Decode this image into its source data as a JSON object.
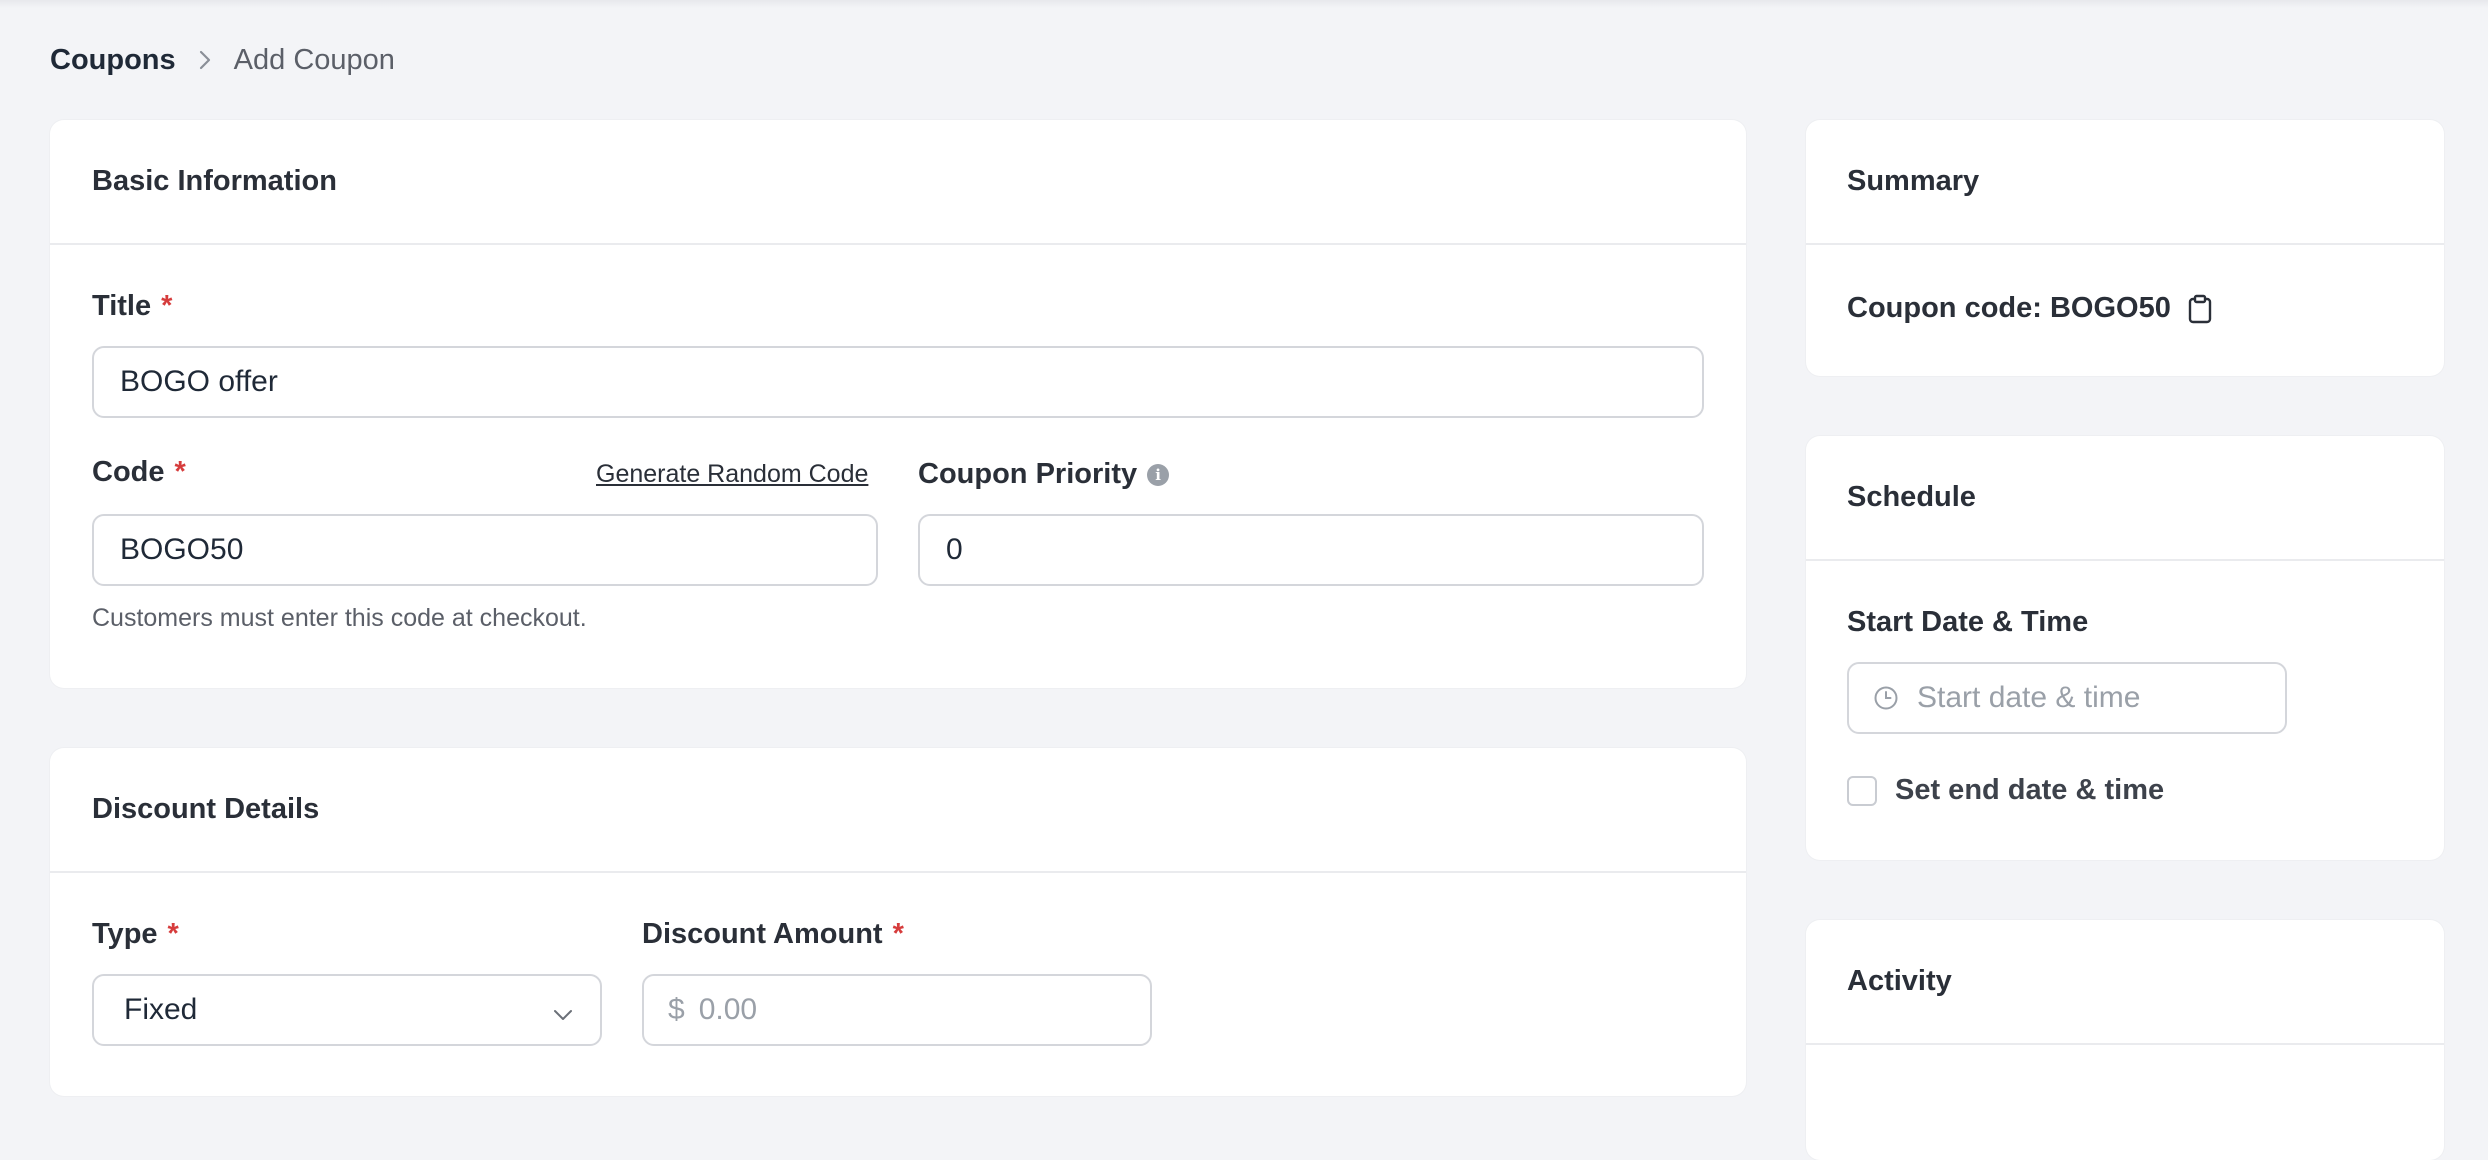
{
  "breadcrumb": {
    "root": "Coupons",
    "current": "Add Coupon"
  },
  "basic_info": {
    "heading": "Basic Information",
    "title_label": "Title",
    "title_value": "BOGO offer",
    "code_label": "Code",
    "generate_link": "Generate Random Code",
    "code_value": "BOGO50",
    "code_helper": "Customers must enter this code at checkout.",
    "priority_label": "Coupon Priority",
    "priority_value": "0",
    "required_mark": "*"
  },
  "discount": {
    "heading": "Discount Details",
    "type_label": "Type",
    "type_value": "Fixed",
    "amount_label": "Discount Amount",
    "currency_symbol": "$",
    "amount_placeholder": "0.00",
    "required_mark": "*"
  },
  "summary": {
    "heading": "Summary",
    "coupon_code_text": "Coupon code: BOGO50",
    "copy_icon": "clipboard-icon"
  },
  "schedule": {
    "heading": "Schedule",
    "start_label": "Start Date & Time",
    "start_placeholder": "Start date & time",
    "end_checkbox_label": "Set end date & time",
    "end_checked": false
  },
  "activity": {
    "heading": "Activity"
  },
  "colors": {
    "background": "#f3f4f7",
    "card": "#ffffff",
    "required": "#d63c3c",
    "border": "#d4d6db"
  }
}
